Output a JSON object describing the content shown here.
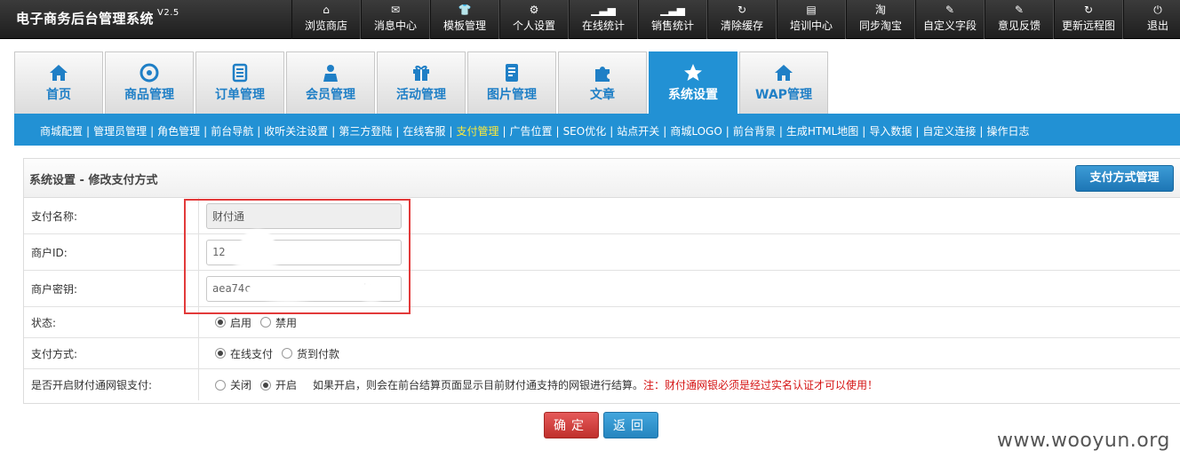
{
  "app": {
    "title": "电子商务后台管理系统",
    "version": "V2.5"
  },
  "topnav": [
    {
      "label": "浏览商店",
      "icon": "home-icon",
      "glyph": "⌂"
    },
    {
      "label": "消息中心",
      "icon": "envelope-icon",
      "glyph": "✉"
    },
    {
      "label": "模板管理",
      "icon": "shirt-icon",
      "glyph": "👕"
    },
    {
      "label": "个人设置",
      "icon": "gear-icon",
      "glyph": "⚙"
    },
    {
      "label": "在线统计",
      "icon": "signal-icon",
      "glyph": "▁▃▅"
    },
    {
      "label": "销售统计",
      "icon": "signal-icon",
      "glyph": "▁▃▅"
    },
    {
      "label": "清除缓存",
      "icon": "refresh-icon",
      "glyph": "↻"
    },
    {
      "label": "培训中心",
      "icon": "document-icon",
      "glyph": "▤"
    },
    {
      "label": "同步淘宝",
      "icon": "taobao-icon",
      "glyph": "淘"
    },
    {
      "label": "自定义字段",
      "icon": "pencil-icon",
      "glyph": "✎"
    },
    {
      "label": "意见反馈",
      "icon": "pencil-icon",
      "glyph": "✎"
    },
    {
      "label": "更新远程图",
      "icon": "refresh-icon",
      "glyph": "↻"
    },
    {
      "label": "退出",
      "icon": "power-icon",
      "glyph": "⏻"
    }
  ],
  "tabs": [
    {
      "label": "首页",
      "icon": "home-icon"
    },
    {
      "label": "商品管理",
      "icon": "target-icon"
    },
    {
      "label": "订单管理",
      "icon": "list-icon"
    },
    {
      "label": "会员管理",
      "icon": "user-icon"
    },
    {
      "label": "活动管理",
      "icon": "gift-icon"
    },
    {
      "label": "图片管理",
      "icon": "image-icon"
    },
    {
      "label": "文章",
      "icon": "puzzle-icon"
    },
    {
      "label": "系统设置",
      "icon": "star-icon",
      "active": true
    },
    {
      "label": "WAP管理",
      "icon": "home-icon"
    }
  ],
  "subnav": [
    "商城配置",
    "管理员管理",
    "角色管理",
    "前台导航",
    "收听关注设置",
    "第三方登陆",
    "在线客服",
    "支付管理",
    "广告位置",
    "SEO优化",
    "站点开关",
    "商城LOGO",
    "前台背景",
    "生成HTML地图",
    "导入数据",
    "自定义连接",
    "操作日志"
  ],
  "subnav_active": "支付管理",
  "panel": {
    "title": "系统设置 - 修改支付方式",
    "manage_button": "支付方式管理",
    "fields": {
      "pay_name": {
        "label": "支付名称:",
        "value": "财付通"
      },
      "merchant_id": {
        "label": "商户ID:",
        "value": "12"
      },
      "merchant_key": {
        "label": "商户密钥:",
        "value": "aea74c                 d4"
      },
      "status": {
        "label": "状态:",
        "options": [
          "启用",
          "禁用"
        ],
        "selected": "启用"
      },
      "pay_method": {
        "label": "支付方式:",
        "options": [
          "在线支付",
          "货到付款"
        ],
        "selected": "在线支付"
      },
      "netbank": {
        "label": "是否开启财付通网银支付:",
        "options": [
          "关闭",
          "开启"
        ],
        "selected": "开启",
        "hint": "如果开启，则会在前台结算页面显示目前财付通支持的网银进行结算。",
        "warning": "注：财付通网银必须是经过实名认证才可以使用！"
      }
    }
  },
  "buttons": {
    "confirm": "确定",
    "back": "返回"
  },
  "watermark": "www.wooyun.org"
}
